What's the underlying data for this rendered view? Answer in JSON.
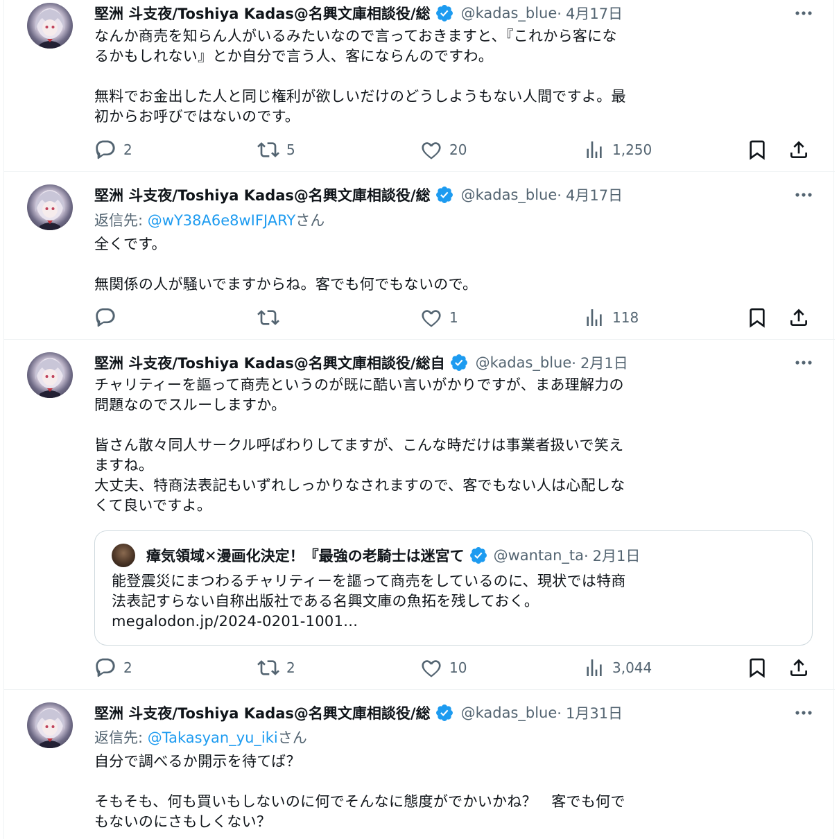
{
  "tweets": [
    {
      "author": "堅洲 斗支夜/Toshiya Kadas@名興文庫相談役/総",
      "handle": "@kadas_blue",
      "date": "4月17日",
      "body": [
        "なんか商売を知らん人がいるみたいなので言っておきますと、『これから客にな",
        "るかもしれない』とか自分で言う人、客にならんのですわ。",
        "",
        "無料でお金出した人と同じ権利が欲しいだけのどうしようもない人間ですよ。最",
        "初からお呼びではないのです。"
      ],
      "replies": "2",
      "retweets": "5",
      "likes": "20",
      "views": "1,250"
    },
    {
      "author": "堅洲 斗支夜/Toshiya Kadas@名興文庫相談役/総",
      "handle": "@kadas_blue",
      "date": "4月17日",
      "reply_prefix": "返信先: ",
      "reply_mention": "@wY38A6e8wIFJARY",
      "reply_suffix": "さん",
      "body": [
        "全くです。",
        "",
        "無関係の人が騒いでますからね。客でも何でもないので。"
      ],
      "replies": "",
      "retweets": "",
      "likes": "1",
      "views": "118"
    },
    {
      "author": "堅洲 斗支夜/Toshiya Kadas@名興文庫相談役/総自",
      "handle": "@kadas_blue",
      "date": "2月1日",
      "body": [
        "チャリティーを謳って商売というのが既に酷い言いがかりですが、まあ理解力の",
        "問題なのでスルーしますか。",
        "",
        "皆さん散々同人サークル呼ばわりしてますが、こんな時だけは事業者扱いで笑え",
        "ますね。",
        "大丈夫、特商法表記もいずれしっかりなされますので、客でもない人は心配しな",
        "くて良いですよ。"
      ],
      "quote": {
        "author": "瘴気領域✕漫画化決定！『最強の老騎士は迷宮て",
        "handle": "@wantan_ta",
        "date": "2月1日",
        "body": [
          "能登震災にまつわるチャリティーを謳って商売をしているのに、現状では特商",
          "法表記すらない自称出版社である名興文庫の魚拓を残しておく。",
          "megalodon.jp/2024-0201-1001..."
        ]
      },
      "replies": "2",
      "retweets": "2",
      "likes": "10",
      "views": "3,044"
    },
    {
      "author": "堅洲 斗支夜/Toshiya Kadas@名興文庫相談役/総",
      "handle": "@kadas_blue",
      "date": "1月31日",
      "reply_prefix": "返信先: ",
      "reply_mention": "@Takasyan_yu_iki",
      "reply_suffix": "さん",
      "body": [
        "自分で調べるか開示を待てば？",
        "",
        "そもそも、何も買いもしないのに何でそんなに態度がでかいかね？　客でも何で",
        "もないのにさもしくない？"
      ]
    }
  ],
  "icons": {
    "reply": "reply-icon",
    "retweet": "retweet-icon",
    "like": "heart-icon",
    "views": "views-icon",
    "bookmark": "bookmark-icon",
    "share": "share-icon",
    "more": "more-icon",
    "verified": "verified-badge-icon"
  },
  "colors": {
    "link": "#1d9bf0",
    "secondary_text": "#536471",
    "border": "#eff3f4",
    "verified": "#1d9bf0"
  }
}
